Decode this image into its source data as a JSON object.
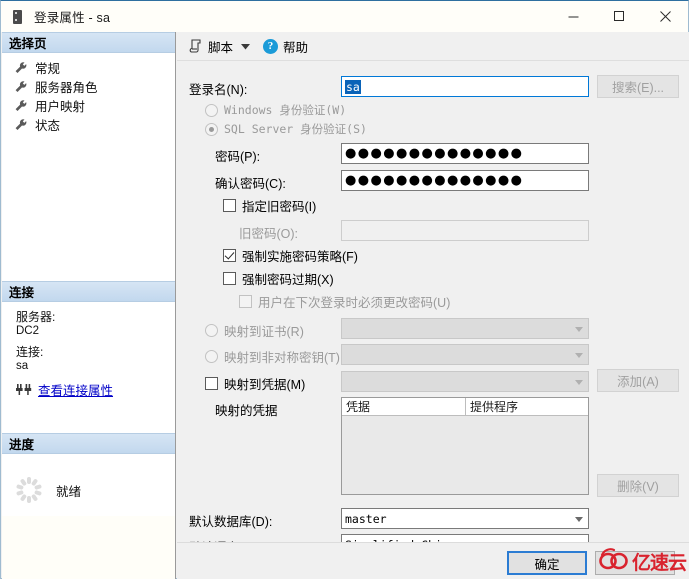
{
  "window": {
    "title": "登录属性 - sa",
    "icon": "server-icon",
    "minimize": "—",
    "maximize": "□",
    "close": "✕"
  },
  "sidebar": {
    "select_page_header": "选择页",
    "pages": [
      {
        "label": "常规",
        "icon": "wrench-icon"
      },
      {
        "label": "服务器角色",
        "icon": "wrench-icon"
      },
      {
        "label": "用户映射",
        "icon": "wrench-icon"
      },
      {
        "label": "状态",
        "icon": "wrench-icon"
      }
    ],
    "connection_header": "连接",
    "server_label": "服务器:",
    "server_value": "DC2",
    "connection_label": "连接:",
    "connection_value": "sa",
    "view_connection_link": "查看连接属性",
    "progress_header": "进度",
    "progress_status": "就绪"
  },
  "toolbar": {
    "script_label": "脚本",
    "script_icon": "script-icon",
    "caret_icon": "chevron-down-icon",
    "help_label": "帮助",
    "help_icon": "help-icon"
  },
  "form": {
    "login_name_label": "登录名(N):",
    "login_name_value": "sa",
    "search_button": "搜索(E)...",
    "windows_auth_label": "Windows 身份验证(W)",
    "windows_auth_checked": false,
    "sql_auth_label": "SQL Server 身份验证(S)",
    "sql_auth_checked": true,
    "password_label": "密码(P):",
    "password_value": "●●●●●●●●●●●●●●",
    "confirm_password_label": "确认密码(C):",
    "confirm_password_value": "●●●●●●●●●●●●●●",
    "specify_old_password_label": "指定旧密码(I)",
    "specify_old_password_checked": false,
    "old_password_label": "旧密码(O):",
    "old_password_value": "",
    "enforce_policy_label": "强制实施密码策略(F)",
    "enforce_policy_checked": true,
    "enforce_expiration_label": "强制密码过期(X)",
    "enforce_expiration_checked": false,
    "must_change_label": "用户在下次登录时必须更改密码(U)",
    "must_change_checked": false,
    "map_certificate_label": "映射到证书(R)",
    "map_certificate_checked": false,
    "map_certificate_value": "",
    "map_asymmetric_label": "映射到非对称密钥(T)",
    "map_asymmetric_checked": false,
    "map_asymmetric_value": "",
    "map_credential_label": "映射到凭据(M)",
    "map_credential_checked": false,
    "map_credential_value": "",
    "add_button": "添加(A)",
    "mapped_credentials_label": "映射的凭据",
    "credentials_columns": [
      "凭据",
      "提供程序"
    ],
    "credentials_rows": [],
    "delete_button": "删除(V)",
    "default_database_label": "默认数据库(D):",
    "default_database_value": "master",
    "default_language_label": "默认语言(G):",
    "default_language_value": "Simplified Chinese"
  },
  "footer": {
    "ok_button": "确定"
  },
  "watermark": {
    "text": "亿速云"
  }
}
